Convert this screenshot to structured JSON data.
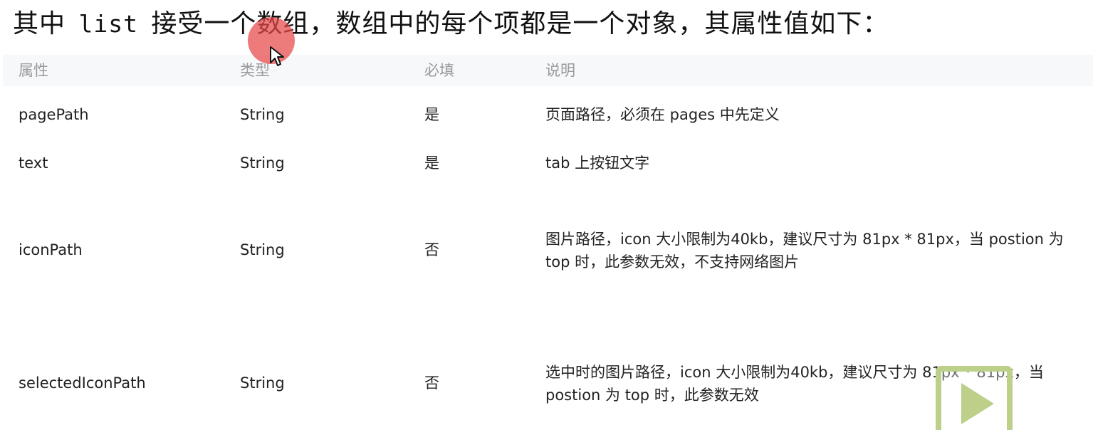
{
  "heading": {
    "prefix": "其中",
    "code": "list",
    "suffix": "接受一个数组，数组中的每个项都是一个对象，其属性值如下："
  },
  "table": {
    "headers": [
      "属性",
      "类型",
      "必填",
      "说明"
    ],
    "rows": [
      {
        "name": "pagePath",
        "type": "String",
        "required": "是",
        "desc": "页面路径，必须在 pages 中先定义"
      },
      {
        "name": "text",
        "type": "String",
        "required": "是",
        "desc": "tab 上按钮文字"
      },
      {
        "name": "iconPath",
        "type": "String",
        "required": "否",
        "desc": "图片路径，icon 大小限制为40kb，建议尺寸为 81px * 81px，当 postion 为 top 时，此参数无效，不支持网络图片"
      },
      {
        "name": "selectedIconPath",
        "type": "String",
        "required": "否",
        "desc": "选中时的图片路径，icon 大小限制为40kb，建议尺寸为 81px * 81px，当 postion 为 top 时，此参数无效"
      }
    ]
  },
  "overlay": {
    "cursor_icon": "cursor-arrow-icon",
    "cursor_highlight_color": "#e84848",
    "play_icon": "play-icon",
    "play_color": "#bcd08a"
  }
}
